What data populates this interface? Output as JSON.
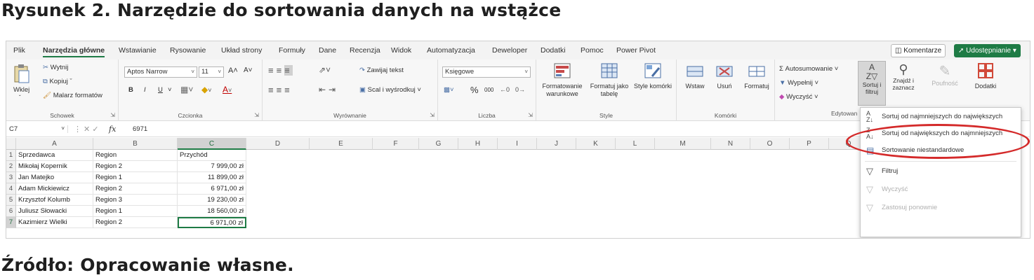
{
  "caption_top": "Rysunek 2. Narzędzie do sortowania danych na wstążce",
  "caption_bottom": "Źródło: Opracowanie własne.",
  "tabs": [
    "Plik",
    "Narzędzia główne",
    "Wstawianie",
    "Rysowanie",
    "Układ strony",
    "Formuły",
    "Dane",
    "Recenzja",
    "Widok",
    "Automatyzacja",
    "Deweloper",
    "Dodatki",
    "Pomoc",
    "Power Pivot"
  ],
  "top_buttons": {
    "comments": "Komentarze",
    "share": "Udostępnianie"
  },
  "ribbon": {
    "clipboard": {
      "paste": "Wklej",
      "cut": "Wytnij",
      "copy": "Kopiuj",
      "painter": "Malarz formatów",
      "label": "Schowek"
    },
    "font": {
      "name": "Aptos Narrow",
      "size": "11",
      "grow": "A˄",
      "shrink": "A˅",
      "bold": "B",
      "italic": "I",
      "underline": "U",
      "label": "Czcionka"
    },
    "alignment": {
      "wrap": "Zawijaj tekst",
      "merge": "Scal i wyśrodkuj",
      "label": "Wyrównanie"
    },
    "number": {
      "format": "Księgowe",
      "percent": "%",
      "thousands": "000",
      "label": "Liczba"
    },
    "styles": {
      "conditional": "Formatowanie warunkowe",
      "table": "Formatuj jako tabelę",
      "cell_styles": "Style komórki",
      "label": "Style"
    },
    "cells": {
      "insert": "Wstaw",
      "delete": "Usuń",
      "format": "Formatuj",
      "label": "Komórki"
    },
    "editing": {
      "autosum": "Autosumowanie",
      "fill": "Wypełnij",
      "clear": "Wyczyść",
      "sort": "Sortuj i filtruj",
      "find": "Znajdź i zaznacz",
      "label": "Edytowan"
    },
    "sensitivity": "Poufność",
    "addins": "Dodatki"
  },
  "formula_bar": {
    "cell_ref": "C7",
    "fx": "fx",
    "value": "6971"
  },
  "columns": [
    "A",
    "B",
    "C",
    "D",
    "E",
    "F",
    "G",
    "H",
    "I",
    "J",
    "K",
    "L",
    "M",
    "N",
    "O",
    "P",
    "Q"
  ],
  "rows": [
    [
      "1",
      "Sprzedawca",
      "Region",
      "Przychód"
    ],
    [
      "2",
      "Mikołaj Kopernik",
      "Region 2",
      "7 999,00 zł"
    ],
    [
      "3",
      "Jan Matejko",
      "Region 1",
      "11 899,00 zł"
    ],
    [
      "4",
      "Adam Mickiewicz",
      "Region 2",
      "6 971,00 zł"
    ],
    [
      "5",
      "Krzysztof Kolumb",
      "Region 3",
      "19 230,00 zł"
    ],
    [
      "6",
      "Juliusz Słowacki",
      "Region 1",
      "18 560,00 zł"
    ],
    [
      "7",
      "Kazimierz Wielki",
      "Region 2",
      "6 971,00 zł"
    ]
  ],
  "menu": [
    {
      "label": "Sortuj od najmniejszych do największych",
      "disabled": false
    },
    {
      "label": "Sortuj od największych do najmniejszych",
      "disabled": false
    },
    {
      "label": "Sortowanie niestandardowe",
      "disabled": false
    },
    {
      "label": "Filtruj",
      "disabled": false
    },
    {
      "label": "Wyczyść",
      "disabled": true
    },
    {
      "label": "Zastosuj ponownie",
      "disabled": true
    }
  ],
  "colors": {
    "accent": "#1e7b45",
    "highlight": "#d42a2a"
  },
  "icons": [
    "paste-icon",
    "cut-icon",
    "copy-icon",
    "format-painter-icon",
    "wrap-text-icon",
    "merge-icon",
    "conditional-format-icon",
    "format-table-icon",
    "cell-styles-icon",
    "insert-cells-icon",
    "delete-cells-icon",
    "format-cells-icon",
    "autosum-icon",
    "fill-icon",
    "clear-icon",
    "sort-filter-icon",
    "find-icon",
    "sensitivity-icon",
    "addins-icon",
    "sort-asc-icon",
    "sort-desc-icon",
    "custom-sort-icon",
    "filter-icon",
    "clear-filter-icon",
    "reapply-icon"
  ]
}
